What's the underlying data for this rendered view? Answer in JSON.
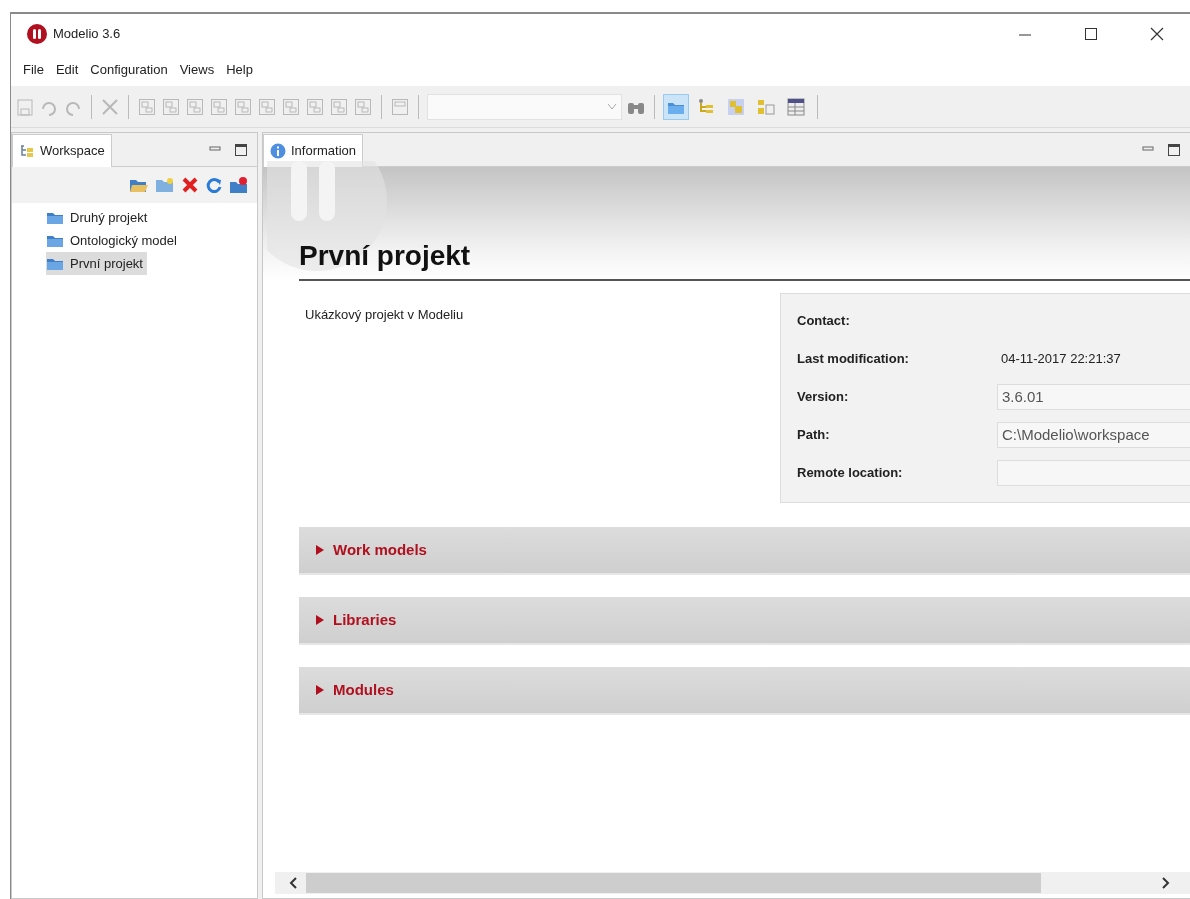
{
  "window": {
    "title": "Modelio 3.6"
  },
  "menu": [
    "File",
    "Edit",
    "Configuration",
    "Views",
    "Help"
  ],
  "toolbar": {
    "view_toggles": [
      {
        "selected": true
      },
      {
        "selected": false
      },
      {
        "selected": false
      },
      {
        "selected": false
      },
      {
        "selected": false
      }
    ]
  },
  "workspace": {
    "tab": "Workspace",
    "projects": [
      {
        "label": "Druhý projekt",
        "selected": false
      },
      {
        "label": "Ontologický model",
        "selected": false
      },
      {
        "label": "První projekt",
        "selected": true
      }
    ]
  },
  "information": {
    "tab": "Information",
    "title": "První projekt",
    "description": "Ukázkový projekt v Modeliu",
    "properties": [
      {
        "label": "Contact:",
        "kind": "text"
      },
      {
        "label": "Last modification:",
        "kind": "text",
        "value": "04-11-2017 22:21:37"
      },
      {
        "label": "Version:",
        "kind": "field",
        "value": "3.6.01"
      },
      {
        "label": "Path:",
        "kind": "field",
        "value": "C:\\Modelio\\workspace"
      },
      {
        "label": "Remote location:",
        "kind": "field"
      }
    ],
    "sections": [
      {
        "label": "Work models",
        "expanded": false
      },
      {
        "label": "Libraries",
        "expanded": false
      },
      {
        "label": "Modules",
        "expanded": false
      }
    ]
  }
}
